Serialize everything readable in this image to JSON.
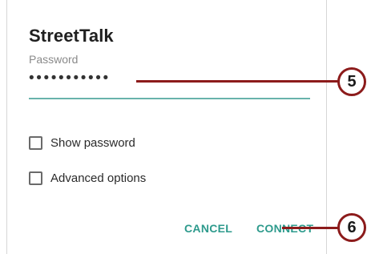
{
  "dialog": {
    "title": "StreetTalk",
    "password_label": "Password",
    "password_value": "•••••••••••",
    "checkboxes": [
      {
        "label": "Show password",
        "checked": false
      },
      {
        "label": "Advanced options",
        "checked": false
      }
    ],
    "actions": {
      "cancel_label": "CANCEL",
      "connect_label": "CONNECT"
    },
    "accent_color": "#2d9a8c"
  },
  "callouts": [
    {
      "number": "5"
    },
    {
      "number": "6"
    }
  ]
}
